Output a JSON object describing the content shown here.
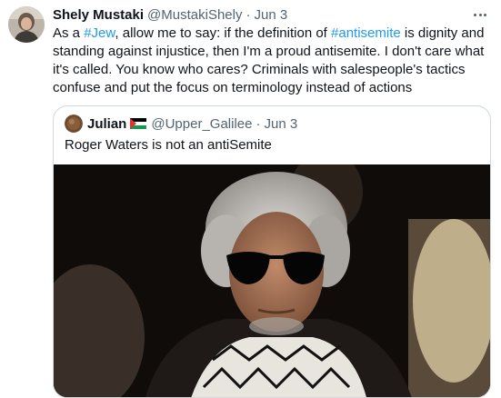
{
  "tweet": {
    "author_name": "Shely Mustaki",
    "author_handle": "@MustakiShely",
    "separator": "·",
    "date": "Jun 3",
    "more_icon": "more-horizontal-icon",
    "text_parts": [
      "As a ",
      "#Jew",
      ", allow me to say: if the definition of ",
      "#antisemite",
      " is dignity and standing against injustice, then I'm a proud antisemite. I don't care what it's called. You know who cares? Criminals with salespeople's tactics confuse and put the focus on terminology instead of actions"
    ],
    "hashtag_color": "#1d9bf0"
  },
  "quoted": {
    "author_name": "Julian",
    "flag_icon": "palestine-flag-icon",
    "author_handle": "@Upper_Galilee",
    "separator": "·",
    "date": "Jun 3",
    "text": "Roger Waters is not an antiSemite",
    "image_icon": "photo-man-sunglasses-keffiyeh"
  }
}
